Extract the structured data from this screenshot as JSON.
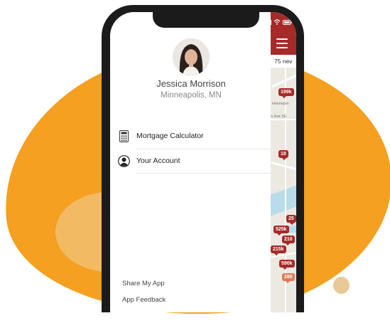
{
  "colors": {
    "accent": "#a62a27",
    "brand_orange": "#f5a020",
    "pin_light": "#e07b55"
  },
  "status_bar": {
    "icons": [
      "signal-icon",
      "wifi-icon",
      "battery-icon"
    ]
  },
  "profile": {
    "name": "Jessica Morrison",
    "location": "Minneapolis, MN"
  },
  "menu": {
    "items": [
      {
        "label": "Mortgage Calculator",
        "icon": "calculator-icon"
      },
      {
        "label": "Your Account",
        "icon": "account-icon"
      }
    ]
  },
  "footer": {
    "links": [
      "Share My App",
      "App Feedback"
    ]
  },
  "map": {
    "header_icon": "hamburger-menu-icon",
    "count_label": "75 nev",
    "street_labels": [
      "Hennepin",
      "o Ave SE"
    ],
    "price_pins": [
      {
        "label": "199k",
        "style": "dark"
      },
      {
        "label": "18",
        "style": "dark"
      },
      {
        "label": "25",
        "style": "dark"
      },
      {
        "label": "525k",
        "style": "dark"
      },
      {
        "label": "210",
        "style": "dark"
      },
      {
        "label": "215k",
        "style": "dark"
      },
      {
        "label": "590k",
        "style": "dark"
      },
      {
        "label": "280",
        "style": "light"
      }
    ]
  }
}
